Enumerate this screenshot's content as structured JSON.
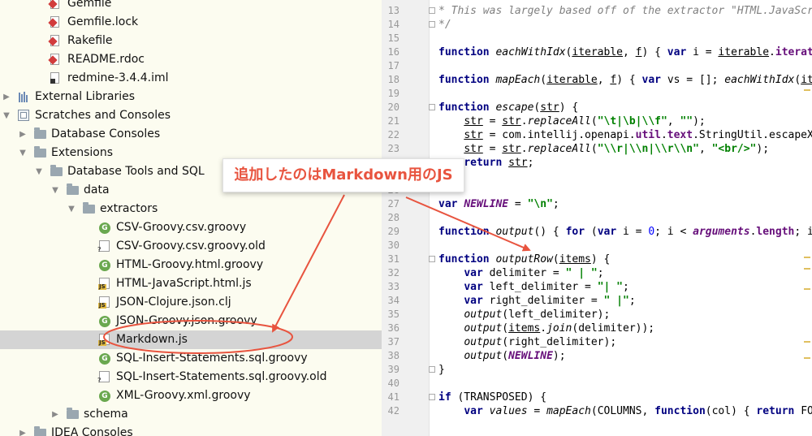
{
  "tree": {
    "rows": [
      {
        "label": "Gemfile",
        "icon": "ruby-file",
        "indent": 2,
        "arrow": "none",
        "selected": false
      },
      {
        "label": "Gemfile.lock",
        "icon": "ruby-file",
        "indent": 2,
        "arrow": "none",
        "selected": false
      },
      {
        "label": "Rakefile",
        "icon": "ruby-file",
        "indent": 2,
        "arrow": "none",
        "selected": false
      },
      {
        "label": "README.rdoc",
        "icon": "ruby-file",
        "indent": 2,
        "arrow": "none",
        "selected": false
      },
      {
        "label": "redmine-3.4.4.iml",
        "icon": "iml-file",
        "indent": 2,
        "arrow": "none",
        "selected": false
      },
      {
        "label": "External Libraries",
        "icon": "library",
        "indent": 0,
        "arrow": "right",
        "selected": false
      },
      {
        "label": "Scratches and Consoles",
        "icon": "scratches",
        "indent": 0,
        "arrow": "down",
        "selected": false
      },
      {
        "label": "Database Consoles",
        "icon": "folder",
        "indent": 1,
        "arrow": "right",
        "selected": false
      },
      {
        "label": "Extensions",
        "icon": "folder",
        "indent": 1,
        "arrow": "down",
        "selected": false
      },
      {
        "label": "Database Tools and SQL",
        "icon": "folder",
        "indent": 2,
        "arrow": "down",
        "selected": false
      },
      {
        "label": "data",
        "icon": "folder",
        "indent": 3,
        "arrow": "down",
        "selected": false
      },
      {
        "label": "extractors",
        "icon": "folder",
        "indent": 4,
        "arrow": "down",
        "selected": false
      },
      {
        "label": "CSV-Groovy.csv.groovy",
        "icon": "groovy",
        "indent": 5,
        "arrow": "none",
        "selected": false
      },
      {
        "label": "CSV-Groovy.csv.groovy.old",
        "icon": "unknown-groovy",
        "indent": 5,
        "arrow": "none",
        "selected": false
      },
      {
        "label": "HTML-Groovy.html.groovy",
        "icon": "groovy",
        "indent": 5,
        "arrow": "none",
        "selected": false
      },
      {
        "label": "HTML-JavaScript.html.js",
        "icon": "js",
        "indent": 5,
        "arrow": "none",
        "selected": false
      },
      {
        "label": "JSON-Clojure.json.clj",
        "icon": "js",
        "indent": 5,
        "arrow": "none",
        "selected": false
      },
      {
        "label": "JSON-Groovy.json.groovy",
        "icon": "groovy",
        "indent": 5,
        "arrow": "none",
        "selected": false
      },
      {
        "label": "Markdown.js",
        "icon": "js",
        "indent": 5,
        "arrow": "none",
        "selected": true
      },
      {
        "label": "SQL-Insert-Statements.sql.groovy",
        "icon": "groovy",
        "indent": 5,
        "arrow": "none",
        "selected": false
      },
      {
        "label": "SQL-Insert-Statements.sql.groovy.old",
        "icon": "unknown-groovy",
        "indent": 5,
        "arrow": "none",
        "selected": false
      },
      {
        "label": "XML-Groovy.xml.groovy",
        "icon": "groovy",
        "indent": 5,
        "arrow": "none",
        "selected": false
      },
      {
        "label": "schema",
        "icon": "folder",
        "indent": 3,
        "arrow": "right",
        "selected": false
      },
      {
        "label": "IDEA Consoles",
        "icon": "folder",
        "indent": 1,
        "arrow": "right",
        "selected": false
      }
    ]
  },
  "editor": {
    "lines": [
      {
        "n": "13",
        "fold": true,
        "t": [
          [
            "cm",
            "* This was largely based off of the extractor \"HTML.JavaScript.html.js\""
          ]
        ]
      },
      {
        "n": "14",
        "fold": true,
        "t": [
          [
            "cm",
            "*/"
          ]
        ]
      },
      {
        "n": "15",
        "fold": false,
        "t": []
      },
      {
        "n": "16",
        "fold": false,
        "t": [
          [
            "kw",
            "function "
          ],
          [
            "fn",
            "eachWithIdx"
          ],
          [
            "pu",
            "("
          ],
          [
            "ul",
            "iterable"
          ],
          [
            "pu",
            ", "
          ],
          [
            "ul",
            "f"
          ],
          [
            "pu",
            ") { "
          ],
          [
            "kw",
            "var "
          ],
          [
            "pu",
            "i = "
          ],
          [
            "ul",
            "iterable"
          ],
          [
            "pu",
            "."
          ],
          [
            "mem",
            "iterator"
          ]
        ]
      },
      {
        "n": "17",
        "fold": false,
        "t": []
      },
      {
        "n": "18",
        "fold": false,
        "t": [
          [
            "kw",
            "function "
          ],
          [
            "fn",
            "mapEach"
          ],
          [
            "pu",
            "("
          ],
          [
            "ul",
            "iterable"
          ],
          [
            "pu",
            ", "
          ],
          [
            "ul",
            "f"
          ],
          [
            "pu",
            ") { "
          ],
          [
            "kw",
            "var "
          ],
          [
            "pu",
            "vs = []; "
          ],
          [
            "fn",
            "eachWithIdx"
          ],
          [
            "pu",
            "("
          ],
          [
            "ul",
            "iterable"
          ]
        ]
      },
      {
        "n": "19",
        "fold": false,
        "t": []
      },
      {
        "n": "20",
        "fold": true,
        "t": [
          [
            "kw",
            "function "
          ],
          [
            "fn",
            "escape"
          ],
          [
            "pu",
            "("
          ],
          [
            "ul",
            "str"
          ],
          [
            "pu",
            ") {"
          ]
        ]
      },
      {
        "n": "21",
        "fold": false,
        "t": [
          [
            "pu",
            "    "
          ],
          [
            "ul",
            "str"
          ],
          [
            "pu",
            " = "
          ],
          [
            "ul",
            "str"
          ],
          [
            "pu",
            "."
          ],
          [
            "fn",
            "replaceAll"
          ],
          [
            "pu",
            "("
          ],
          [
            "str",
            "\"\\t|\\b|\\\\f\""
          ],
          [
            "pu",
            ", "
          ],
          [
            "str",
            "\"\""
          ],
          [
            "pu",
            ");"
          ]
        ]
      },
      {
        "n": "22",
        "fold": false,
        "t": [
          [
            "pu",
            "    "
          ],
          [
            "ul",
            "str"
          ],
          [
            "pu",
            " = com.intellij.openapi."
          ],
          [
            "mem",
            "util"
          ],
          [
            "pu",
            "."
          ],
          [
            "mem",
            "text"
          ],
          [
            "pu",
            ".StringUtil.escapeXml"
          ]
        ]
      },
      {
        "n": "23",
        "fold": false,
        "t": [
          [
            "pu",
            "    "
          ],
          [
            "ul",
            "str"
          ],
          [
            "pu",
            " = "
          ],
          [
            "ul",
            "str"
          ],
          [
            "pu",
            "."
          ],
          [
            "fn",
            "replaceAll"
          ],
          [
            "pu",
            "("
          ],
          [
            "str",
            "\"\\\\r|\\\\n|\\\\r\\\\n\""
          ],
          [
            "pu",
            ", "
          ],
          [
            "str",
            "\"<br/>\""
          ],
          [
            "pu",
            ");"
          ]
        ]
      },
      {
        "n": "24",
        "fold": true,
        "t": [
          [
            "pu",
            "    "
          ],
          [
            "kw",
            "return "
          ],
          [
            "ul",
            "str"
          ],
          [
            "pu",
            ";"
          ]
        ]
      },
      {
        "n": "25",
        "fold": false,
        "t": []
      },
      {
        "n": "26",
        "fold": false,
        "t": []
      },
      {
        "n": "27",
        "fold": false,
        "t": [
          [
            "kw",
            "var "
          ],
          [
            "glob",
            "NEWLINE"
          ],
          [
            "pu",
            " = "
          ],
          [
            "str",
            "\"\\n\""
          ],
          [
            "pu",
            ";"
          ]
        ]
      },
      {
        "n": "28",
        "fold": false,
        "t": []
      },
      {
        "n": "29",
        "fold": false,
        "t": [
          [
            "kw",
            "function "
          ],
          [
            "fn",
            "output"
          ],
          [
            "pu",
            "() { "
          ],
          [
            "kw",
            "for "
          ],
          [
            "pu",
            "("
          ],
          [
            "kw",
            "var "
          ],
          [
            "pu",
            "i = "
          ],
          [
            "num",
            "0"
          ],
          [
            "pu",
            "; i < "
          ],
          [
            "glob",
            "arguments"
          ],
          [
            "pu",
            "."
          ],
          [
            "mem",
            "length"
          ],
          [
            "pu",
            "; i++"
          ]
        ]
      },
      {
        "n": "30",
        "fold": false,
        "t": []
      },
      {
        "n": "31",
        "fold": true,
        "t": [
          [
            "kw",
            "function "
          ],
          [
            "fn",
            "outputRow"
          ],
          [
            "pu",
            "("
          ],
          [
            "ul",
            "items"
          ],
          [
            "pu",
            ") {"
          ]
        ]
      },
      {
        "n": "32",
        "fold": false,
        "t": [
          [
            "pu",
            "    "
          ],
          [
            "kw",
            "var "
          ],
          [
            "pu",
            "delimiter = "
          ],
          [
            "str",
            "\" | \""
          ],
          [
            "pu",
            ";"
          ]
        ]
      },
      {
        "n": "33",
        "fold": false,
        "t": [
          [
            "pu",
            "    "
          ],
          [
            "kw",
            "var "
          ],
          [
            "pu",
            "left_delimiter = "
          ],
          [
            "str",
            "\"| \""
          ],
          [
            "pu",
            ";"
          ]
        ]
      },
      {
        "n": "34",
        "fold": false,
        "t": [
          [
            "pu",
            "    "
          ],
          [
            "kw",
            "var "
          ],
          [
            "pu",
            "right_delimiter = "
          ],
          [
            "str",
            "\" |\""
          ],
          [
            "pu",
            ";"
          ]
        ]
      },
      {
        "n": "35",
        "fold": false,
        "t": [
          [
            "pu",
            "    "
          ],
          [
            "fn",
            "output"
          ],
          [
            "pu",
            "(left_delimiter);"
          ]
        ]
      },
      {
        "n": "36",
        "fold": false,
        "t": [
          [
            "pu",
            "    "
          ],
          [
            "fn",
            "output"
          ],
          [
            "pu",
            "("
          ],
          [
            "ul",
            "items"
          ],
          [
            "pu",
            "."
          ],
          [
            "fn",
            "join"
          ],
          [
            "pu",
            "(delimiter));"
          ]
        ]
      },
      {
        "n": "37",
        "fold": false,
        "t": [
          [
            "pu",
            "    "
          ],
          [
            "fn",
            "output"
          ],
          [
            "pu",
            "(right_delimiter);"
          ]
        ]
      },
      {
        "n": "38",
        "fold": false,
        "t": [
          [
            "pu",
            "    "
          ],
          [
            "fn",
            "output"
          ],
          [
            "pu",
            "("
          ],
          [
            "glob",
            "NEWLINE"
          ],
          [
            "pu",
            ");"
          ]
        ]
      },
      {
        "n": "39",
        "fold": true,
        "t": [
          [
            "pu",
            "}"
          ]
        ]
      },
      {
        "n": "40",
        "fold": false,
        "t": []
      },
      {
        "n": "41",
        "fold": true,
        "t": [
          [
            "kw",
            "if "
          ],
          [
            "pu",
            "(TRANSPOSED) {"
          ]
        ]
      },
      {
        "n": "42",
        "fold": false,
        "t": [
          [
            "pu",
            "    "
          ],
          [
            "kw",
            "var "
          ],
          [
            "fn",
            "values"
          ],
          [
            "pu",
            " = "
          ],
          [
            "fn",
            "mapEach"
          ],
          [
            "pu",
            "(COLUMNS, "
          ],
          [
            "kw",
            "function"
          ],
          [
            "pu",
            "(col) { "
          ],
          [
            "kw",
            "return "
          ],
          [
            "pu",
            "FORMATTER"
          ]
        ]
      }
    ]
  },
  "annotation": {
    "callout_text": "追加したのはMarkdown用のJS",
    "color": "#e8543f"
  }
}
